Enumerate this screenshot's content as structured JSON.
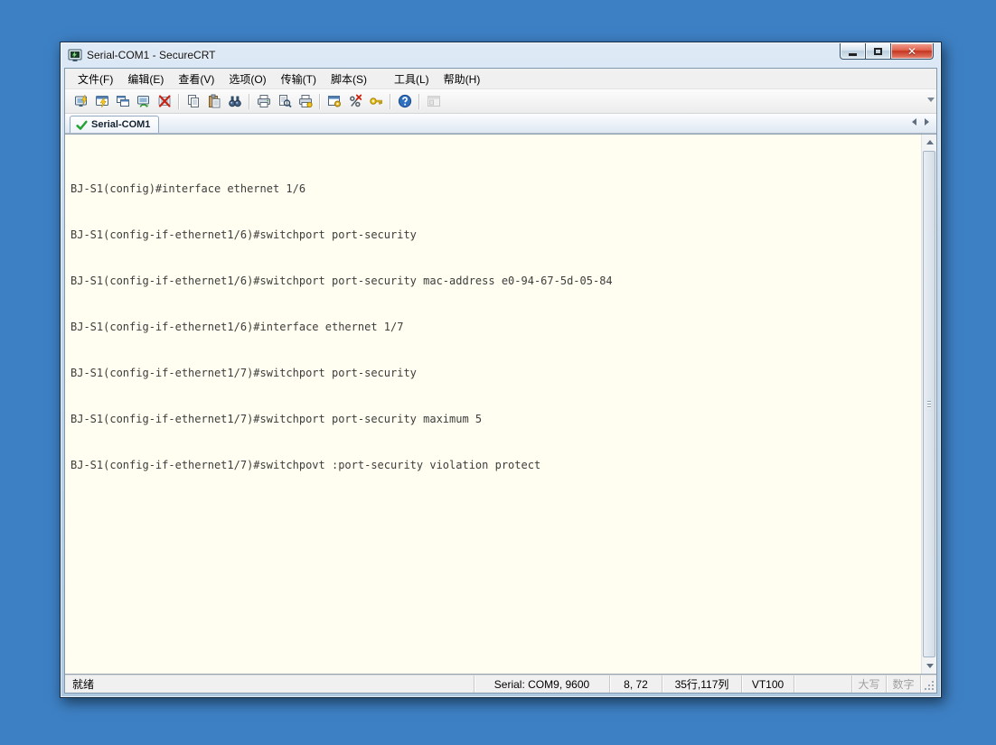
{
  "colors": {
    "desktop": "#3d80c4",
    "terminal_bg": "#fffef0",
    "terminal_text": "#3d3d3d",
    "tab_check_green": "#23a332",
    "close_button_red": "#c33520"
  },
  "window": {
    "title": "Serial-COM1 - SecureCRT",
    "controls": {
      "minimize": "",
      "maximize": "",
      "close": "x"
    }
  },
  "menu": {
    "items": [
      "文件(F)",
      "编辑(E)",
      "查看(V)",
      "选项(O)",
      "传输(T)",
      "脚本(S)",
      "工具(L)",
      "帮助(H)"
    ]
  },
  "toolbar": {
    "icons": [
      "connect",
      "quick-connect",
      "connect-in-tab",
      "reconnect",
      "disconnect",
      "copy",
      "paste",
      "find",
      "print",
      "print-preview",
      "print-setup",
      "session-options",
      "cancel-script",
      "keymap-editor",
      "help",
      "session-manager"
    ]
  },
  "tabbar": {
    "active_tab": "Serial-COM1"
  },
  "terminal": {
    "lines": [
      "BJ-S1(config)#interface ethernet 1/6",
      "BJ-S1(config-if-ethernet1/6)#switchport port-security",
      "BJ-S1(config-if-ethernet1/6)#switchport port-security mac-address e0-94-67-5d-05-84",
      "BJ-S1(config-if-ethernet1/6)#interface ethernet 1/7",
      "BJ-S1(config-if-ethernet1/7)#switchport port-security",
      "BJ-S1(config-if-ethernet1/7)#switchport port-security maximum 5",
      "BJ-S1(config-if-ethernet1/7)#switchpovt :port-security violation protect"
    ]
  },
  "statusbar": {
    "ready": "就绪",
    "serial": "Serial: COM9, 9600",
    "cursor": "8, 72",
    "dimensions": "35行,117列",
    "emulation": "VT100",
    "caps_indicator": "大写",
    "num_indicator": "数字"
  }
}
